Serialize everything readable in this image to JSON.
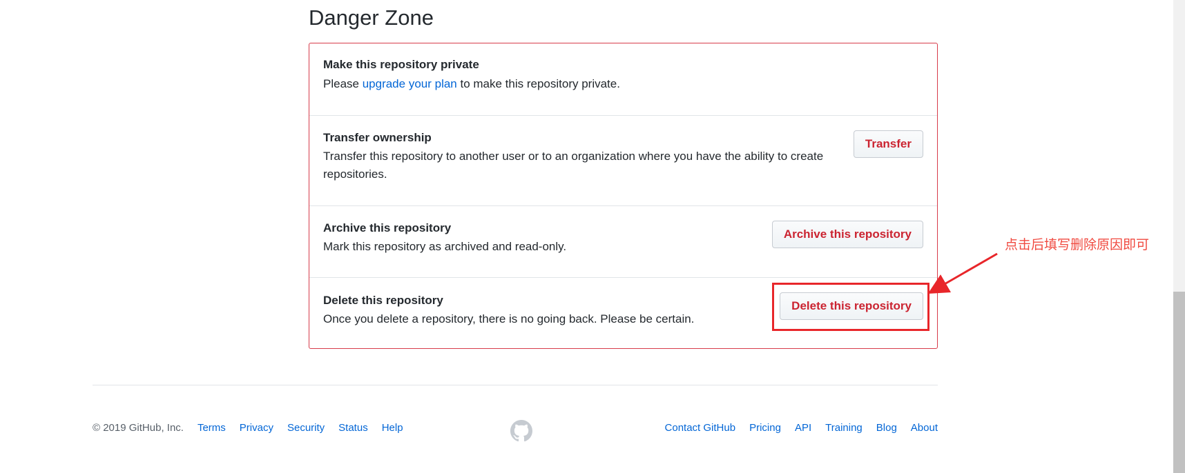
{
  "danger_zone": {
    "title": "Danger Zone",
    "items": [
      {
        "title": "Make this repository private",
        "desc_before": "Please ",
        "desc_link": "upgrade your plan",
        "desc_after": " to make this repository private."
      },
      {
        "title": "Transfer ownership",
        "desc": "Transfer this repository to another user or to an organization where you have the ability to create repositories.",
        "button": "Transfer"
      },
      {
        "title": "Archive this repository",
        "desc": "Mark this repository as archived and read-only.",
        "button": "Archive this repository"
      },
      {
        "title": "Delete this repository",
        "desc": "Once you delete a repository, there is no going back. Please be certain.",
        "button": "Delete this repository"
      }
    ]
  },
  "annotation": {
    "text": "点击后填写删除原因即可",
    "color": "#f04a40"
  },
  "footer": {
    "copyright": "© 2019 GitHub, Inc.",
    "left_links": [
      "Terms",
      "Privacy",
      "Security",
      "Status",
      "Help"
    ],
    "right_links": [
      "Contact GitHub",
      "Pricing",
      "API",
      "Training",
      "Blog",
      "About"
    ],
    "logo_icon": "github-octocat-icon"
  },
  "colors": {
    "danger": "#cb2431",
    "danger_border": "#d73a49",
    "link": "#0366d6",
    "annotation_red": "#e8262a"
  }
}
